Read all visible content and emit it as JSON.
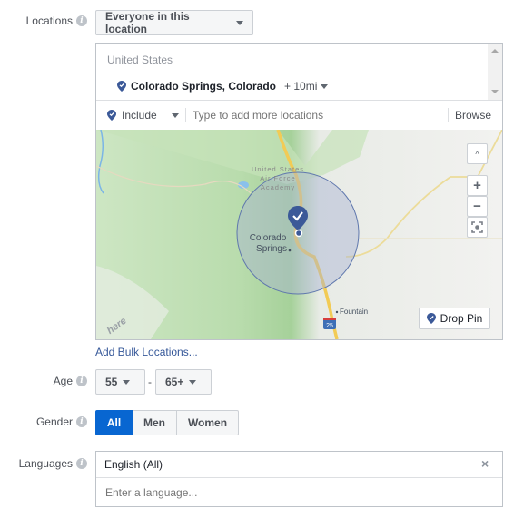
{
  "locations": {
    "label": "Locations",
    "audience_select": "Everyone in this location",
    "country_header": "United States",
    "selected_location": {
      "name": "Colorado Springs, Colorado",
      "radius": "+ 10mi"
    },
    "include_select": "Include",
    "search_placeholder": "Type to add more locations",
    "browse_label": "Browse",
    "map": {
      "labels": {
        "academy": [
          "United States",
          "Air Force",
          "Academy"
        ],
        "city": [
          "Colorado",
          "Springs"
        ],
        "fountain": "Fountain",
        "highway": "25",
        "provider": "here"
      },
      "controls": {
        "collapse": "^",
        "zoom_in": "+",
        "zoom_out": "−"
      },
      "drop_pin_label": "Drop Pin"
    },
    "bulk_link": "Add Bulk Locations..."
  },
  "age": {
    "label": "Age",
    "min": "55",
    "separator": "-",
    "max": "65+"
  },
  "gender": {
    "label": "Gender",
    "options": [
      "All",
      "Men",
      "Women"
    ],
    "selected": "All"
  },
  "languages": {
    "label": "Languages",
    "selected": "English (All)",
    "placeholder": "Enter a language..."
  },
  "colors": {
    "accent": "#0866d1",
    "pin": "#3b5998",
    "link": "#365899"
  }
}
